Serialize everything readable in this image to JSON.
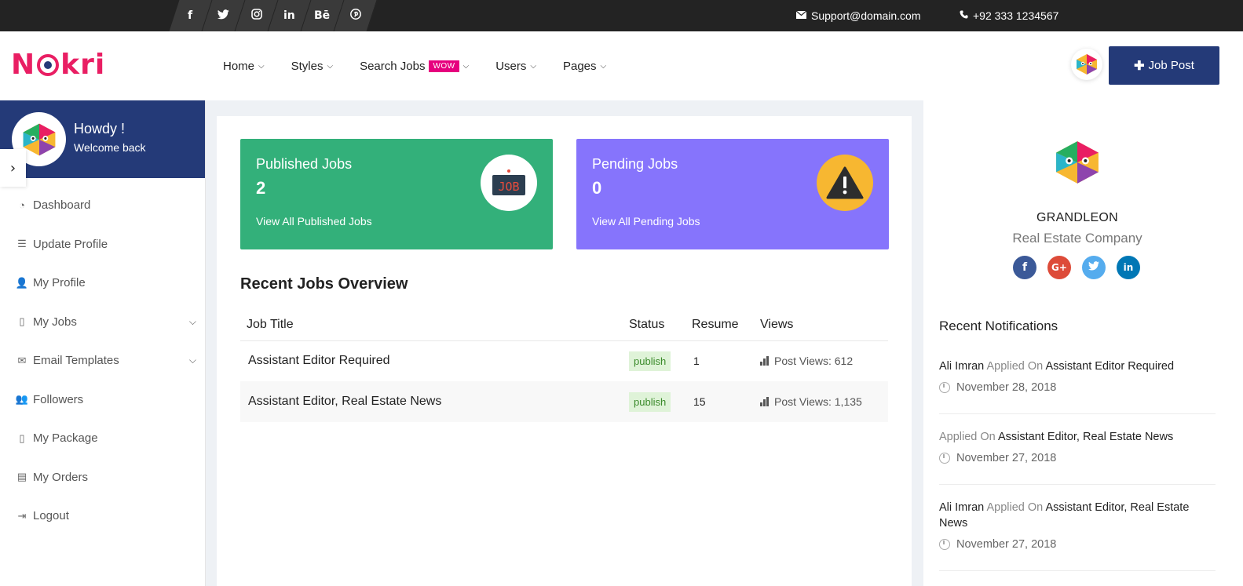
{
  "topbar": {
    "social": [
      {
        "glyph": "f",
        "icon": "facebook-icon"
      },
      {
        "glyph": "🐦",
        "icon": "twitter-icon"
      },
      {
        "glyph": "◎",
        "icon": "instagram-icon"
      },
      {
        "glyph": "in",
        "icon": "linkedin-icon"
      },
      {
        "glyph": "Bē",
        "icon": "behance-icon"
      },
      {
        "glyph": "℗",
        "icon": "pinterest-icon"
      }
    ],
    "email": "Support@domain.com",
    "phone": "+92 333 1234567"
  },
  "header": {
    "logo_left": "N",
    "logo_right": "kri",
    "nav": {
      "home": "Home",
      "styles": "Styles",
      "search_jobs": "Search Jobs",
      "wow": "WOW",
      "users": "Users",
      "pages": "Pages"
    },
    "job_post_label": "Job Post"
  },
  "sidebar": {
    "greeting": "Howdy !",
    "welcome": "Welcome back",
    "items": [
      {
        "label": "Dashboard"
      },
      {
        "label": "Update Profile"
      },
      {
        "label": "My Profile"
      },
      {
        "label": "My Jobs"
      },
      {
        "label": "Email Templates"
      },
      {
        "label": "Followers"
      },
      {
        "label": "My Package"
      },
      {
        "label": "My Orders"
      },
      {
        "label": "Logout"
      }
    ]
  },
  "main": {
    "published": {
      "title": "Published Jobs",
      "count": "2",
      "link": "View All Published Jobs",
      "icon_text": "JOB"
    },
    "pending": {
      "title": "Pending Jobs",
      "count": "0",
      "link": "View All Pending Jobs"
    },
    "section_title": "Recent Jobs Overview",
    "table": {
      "headers": [
        "Job Title",
        "Status",
        "Resume",
        "Views"
      ],
      "rows": [
        {
          "title": "Assistant Editor Required",
          "status": "publish",
          "resume": "1",
          "views": "Post Views: 612"
        },
        {
          "title": "Assistant Editor, Real Estate News",
          "status": "publish",
          "resume": "15",
          "views": "Post Views: 1,135"
        }
      ]
    }
  },
  "company": {
    "name": "GRANDLEON",
    "type": "Real Estate Company",
    "colors": {
      "facebook": "#3b5998",
      "google": "#dd4b39",
      "twitter": "#55acee",
      "linkedin": "#0077b5"
    }
  },
  "notifications": {
    "title": "Recent Notifications",
    "items": [
      {
        "user": "Ali Imran",
        "action": "Applied On",
        "job": "Assistant Editor Required",
        "date": "November 28, 2018"
      },
      {
        "user": "",
        "action": "Applied On",
        "job": "Assistant Editor, Real Estate News",
        "date": "November 27, 2018"
      },
      {
        "user": "Ali Imran",
        "action": "Applied On",
        "job": "Assistant Editor, Real Estate News",
        "date": "November 27, 2018"
      }
    ]
  },
  "colors": {
    "brand": "#e91e63",
    "primary": "#243a78",
    "green": "#33b07a",
    "purple": "#8674fc",
    "warning": "#f7b731"
  }
}
